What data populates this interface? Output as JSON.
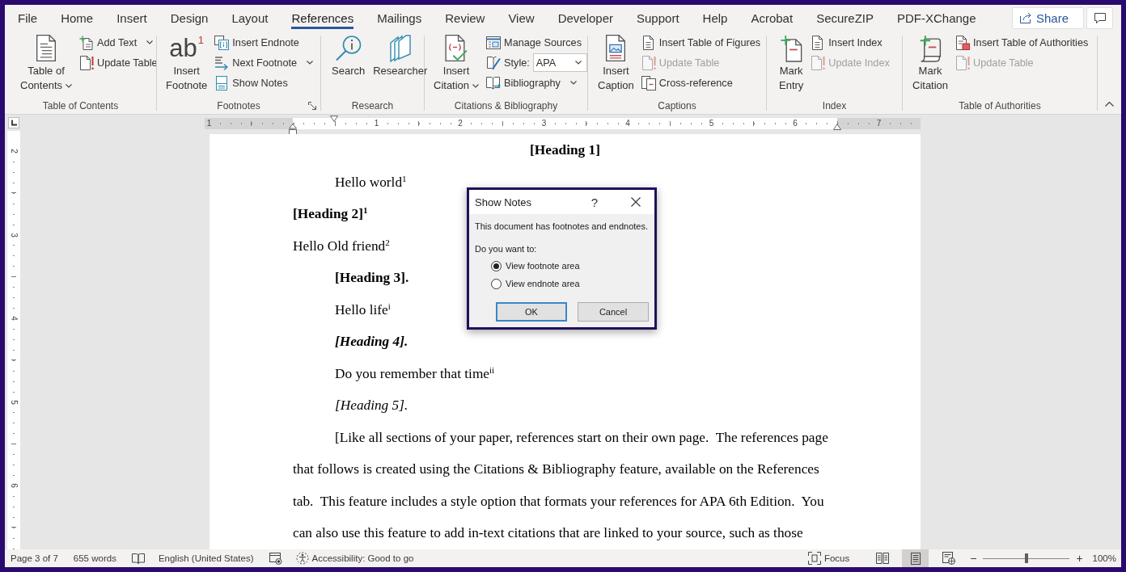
{
  "tabs": [
    {
      "label": "File",
      "selected": false
    },
    {
      "label": "Home",
      "selected": false
    },
    {
      "label": "Insert",
      "selected": false
    },
    {
      "label": "Design",
      "selected": false
    },
    {
      "label": "Layout",
      "selected": false
    },
    {
      "label": "References",
      "selected": true
    },
    {
      "label": "Mailings",
      "selected": false
    },
    {
      "label": "Review",
      "selected": false
    },
    {
      "label": "View",
      "selected": false
    },
    {
      "label": "Developer",
      "selected": false
    },
    {
      "label": "Support",
      "selected": false
    },
    {
      "label": "Help",
      "selected": false
    },
    {
      "label": "Acrobat",
      "selected": false
    },
    {
      "label": "SecureZIP",
      "selected": false
    },
    {
      "label": "PDF-XChange",
      "selected": false
    }
  ],
  "share_button": {
    "label": "Share"
  },
  "ribbon": {
    "groups": [
      {
        "label": "Table of Contents",
        "launcher": false,
        "controls": [
          {
            "kind": "large",
            "lines": [
              "Table of",
              "Contents"
            ],
            "dropdown": true
          },
          {
            "kind": "stack",
            "items": [
              {
                "kind": "button",
                "label": "Add Text",
                "dropdown": true,
                "disabled": false
              },
              {
                "kind": "button",
                "label": "Update Table",
                "dropdown": false,
                "disabled": false
              }
            ]
          }
        ]
      },
      {
        "label": "Footnotes",
        "launcher": true,
        "controls": [
          {
            "kind": "large",
            "symbol": "ab",
            "symbol_mark": "1",
            "lines": [
              "Insert",
              "Footnote"
            ],
            "dropdown": false
          },
          {
            "kind": "stack",
            "items": [
              {
                "kind": "button",
                "label": "Insert Endnote",
                "dropdown": false,
                "disabled": false
              },
              {
                "kind": "button",
                "label": "Next Footnote",
                "dropdown": true,
                "disabled": false
              },
              {
                "kind": "button",
                "label": "Show Notes",
                "dropdown": false,
                "disabled": false
              }
            ]
          }
        ]
      },
      {
        "label": "Research",
        "launcher": false,
        "controls": [
          {
            "kind": "large",
            "lines": [
              "Search"
            ],
            "dropdown": false
          },
          {
            "kind": "large",
            "lines": [
              "Researcher"
            ],
            "dropdown": false
          }
        ]
      },
      {
        "label": "Citations & Bibliography",
        "launcher": false,
        "controls": [
          {
            "kind": "large",
            "lines": [
              "Insert",
              "Citation"
            ],
            "dropdown": true
          },
          {
            "kind": "stack",
            "items": [
              {
                "kind": "button",
                "label": "Manage Sources",
                "dropdown": false,
                "disabled": false
              },
              {
                "kind": "combo",
                "label": "Style:",
                "value": "APA",
                "dropdown": true,
                "disabled": false
              },
              {
                "kind": "button",
                "label": "Bibliography",
                "dropdown": true,
                "disabled": false
              }
            ]
          }
        ]
      },
      {
        "label": "Captions",
        "launcher": false,
        "controls": [
          {
            "kind": "large",
            "lines": [
              "Insert",
              "Caption"
            ],
            "dropdown": false
          },
          {
            "kind": "stack",
            "items": [
              {
                "kind": "button",
                "label": "Insert Table of Figures",
                "dropdown": false,
                "disabled": false
              },
              {
                "kind": "button",
                "label": "Update Table",
                "dropdown": false,
                "disabled": true
              },
              {
                "kind": "button",
                "label": "Cross-reference",
                "dropdown": false,
                "disabled": false
              }
            ]
          }
        ]
      },
      {
        "label": "Index",
        "launcher": false,
        "controls": [
          {
            "kind": "large",
            "lines": [
              "Mark",
              "Entry"
            ],
            "dropdown": false
          },
          {
            "kind": "stack",
            "items": [
              {
                "kind": "button",
                "label": "Insert Index",
                "dropdown": false,
                "disabled": false
              },
              {
                "kind": "button",
                "label": "Update Index",
                "dropdown": false,
                "disabled": true
              }
            ]
          }
        ]
      },
      {
        "label": "Table of Authorities",
        "launcher": false,
        "controls": [
          {
            "kind": "large",
            "lines": [
              "Mark",
              "Citation"
            ],
            "dropdown": false
          },
          {
            "kind": "stack",
            "items": [
              {
                "kind": "button",
                "label": "Insert Table of Authorities",
                "dropdown": false,
                "disabled": false
              },
              {
                "kind": "button",
                "label": "Update Table",
                "dropdown": false,
                "disabled": true
              }
            ]
          }
        ]
      }
    ]
  },
  "ruler": {
    "numbers": [
      "1",
      "1",
      "2",
      "3",
      "4",
      "5",
      "6",
      "7"
    ]
  },
  "vertical_ruler": {
    "numbers": [
      "2",
      "3",
      "4",
      "5",
      "6"
    ]
  },
  "document": {
    "blocks": [
      {
        "kind": "level1",
        "text": "[Heading 1]"
      },
      {
        "kind": "indented",
        "text": "Hello world$^{1}$"
      },
      {
        "kind": "level2",
        "text": "[Heading 2]$^{1}$"
      },
      {
        "kind": "flush",
        "text": "Hello Old friend$^{2}$"
      },
      {
        "kind": "level3",
        "text": "[Heading 3]."
      },
      {
        "kind": "indented",
        "text": "Hello life$^{i}$"
      },
      {
        "kind": "level4",
        "text": "[Heading 4]."
      },
      {
        "kind": "indented",
        "text": "Do you remember that time$^{ii}$"
      },
      {
        "kind": "level5",
        "text": "[Heading 5]."
      },
      {
        "kind": "paragraph",
        "text": "[Like all sections of your paper, references start on their own page.  The references page that follows is created using the Citations & Bibliography feature, available on the References tab.  This feature includes a style option that formats your references for APA 6th Edition.  You can also use this feature to add in-text citations that are linked to your source, such as those"
      }
    ]
  },
  "dialog": {
    "title": "Show Notes",
    "help": "?",
    "message": "This document has footnotes and endnotes.",
    "prompt": "Do you want to:",
    "options": [
      {
        "label": "View footnote area",
        "selected": true
      },
      {
        "label": "View endnote area",
        "selected": false
      }
    ],
    "buttons": [
      {
        "label": "OK",
        "focused": true
      },
      {
        "label": "Cancel",
        "focused": false
      }
    ]
  },
  "status_bar": {
    "page": "Page 3 of 7",
    "words": "655 words",
    "language": "English (United States)",
    "accessibility": "Accessibility: Good to go",
    "focus": "Focus",
    "views": [
      {
        "kind": "read",
        "selected": false
      },
      {
        "kind": "print",
        "selected": true
      },
      {
        "kind": "web",
        "selected": false
      }
    ],
    "zoom": {
      "minus": "−",
      "plus": "+",
      "level": 0.5,
      "reading": "100%"
    }
  }
}
